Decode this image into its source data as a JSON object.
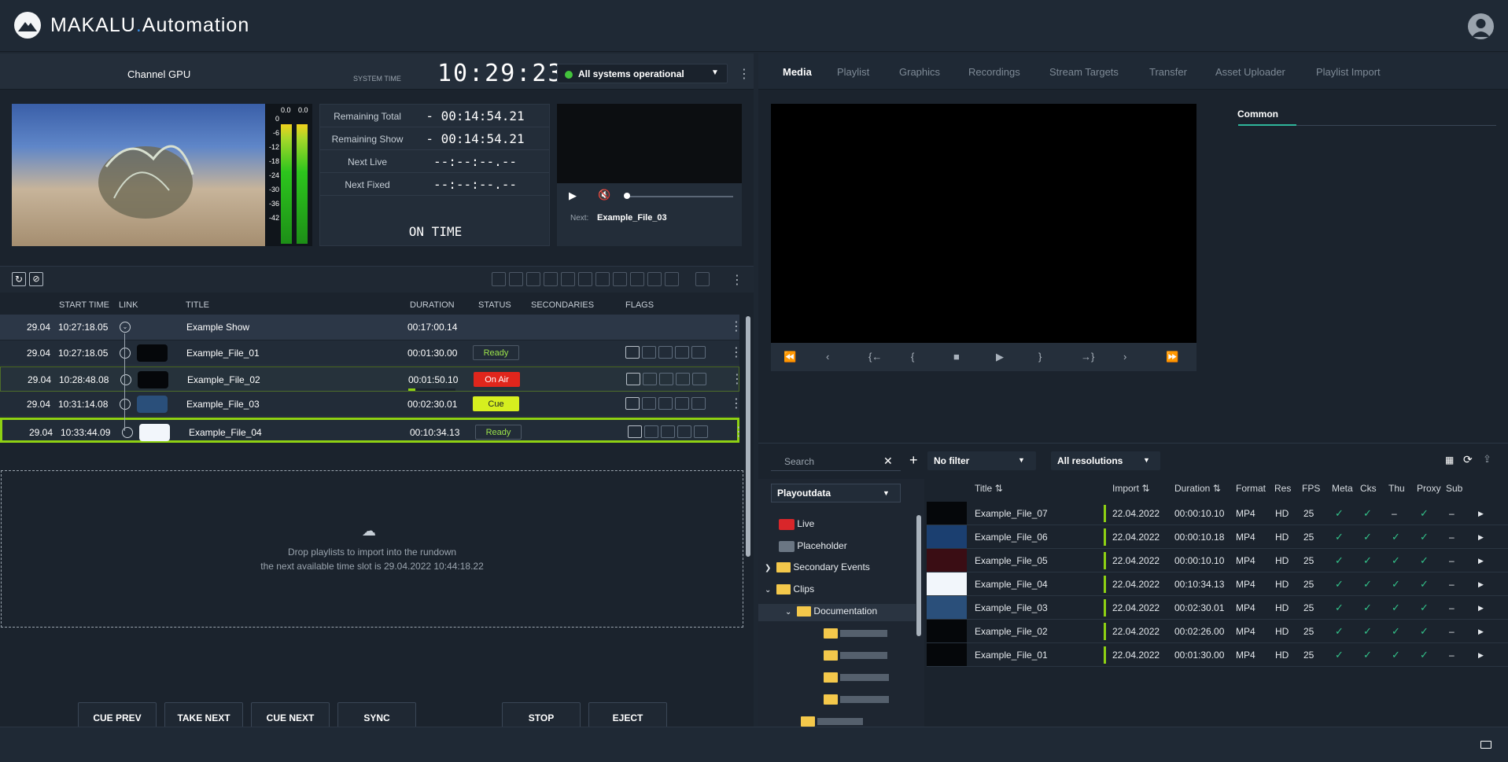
{
  "app": {
    "brand_left": "MAKALU",
    "brand_sep": ".",
    "brand_right": "Automation"
  },
  "channel": {
    "name": "Channel GPU",
    "system_time_label": "SYSTEM TIME",
    "clock": "10:29:23",
    "status": "All systems operational",
    "status_color": "#43c33c"
  },
  "vu": {
    "left_peak": "0.0",
    "right_peak": "0.0",
    "scale": [
      "0",
      "-6",
      "-12",
      "-18",
      "-24",
      "-30",
      "-36",
      "-42"
    ]
  },
  "timers": [
    {
      "label": "Remaining Total",
      "value": "- 00:14:54.21"
    },
    {
      "label": "Remaining Show",
      "value": "- 00:14:54.21"
    },
    {
      "label": "Next Live",
      "value": "--:--:--.--"
    },
    {
      "label": "Next Fixed",
      "value": "--:--:--.--"
    }
  ],
  "on_time": "ON TIME",
  "preview": {
    "next_label": "Next:",
    "next_value": "Example_File_03"
  },
  "rundown": {
    "columns": {
      "start": "START TIME",
      "link": "LINK",
      "title": "TITLE",
      "duration": "DURATION",
      "status": "STATUS",
      "secondaries": "SECONDARIES",
      "flags": "FLAGS"
    },
    "show": {
      "date": "29.04",
      "time": "10:27:18.05",
      "title": "Example Show",
      "duration": "00:17:00.14"
    },
    "items": [
      {
        "date": "29.04",
        "time": "10:27:18.05",
        "title": "Example_File_01",
        "duration": "00:01:30.00",
        "status": "Ready",
        "status_bg": "#222c38",
        "status_fg": "#9be34b",
        "thumb": "#05070a"
      },
      {
        "date": "29.04",
        "time": "10:28:48.08",
        "title": "Example_File_02",
        "duration": "00:01:50.10",
        "status": "On Air",
        "status_bg": "#e0261c",
        "status_fg": "#ffffff",
        "thumb": "#05070a"
      },
      {
        "date": "29.04",
        "time": "10:31:14.08",
        "title": "Example_File_03",
        "duration": "00:02:30.01",
        "status": "Cue",
        "status_bg": "#d6ef1f",
        "status_fg": "#1a1f26",
        "thumb": "#2a4f7a"
      },
      {
        "date": "29.04",
        "time": "10:33:44.09",
        "title": "Example_File_04",
        "duration": "00:10:34.13",
        "status": "Ready",
        "status_bg": "#222c38",
        "status_fg": "#9be34b",
        "thumb": "#f2f6fb"
      }
    ],
    "onair_progress": 0.06,
    "drop_line1": "Drop playlists to import into the rundown",
    "drop_line2": "the next available time slot is 29.04.2022 10:44:18.22"
  },
  "controls": {
    "cue_prev": "CUE PREV",
    "take_next": "TAKE NEXT",
    "cue_next": "CUE NEXT",
    "sync": "SYNC",
    "stop": "STOP",
    "eject": "EJECT"
  },
  "tabs": [
    "Media",
    "Playlist",
    "Graphics",
    "Recordings",
    "Stream Targets",
    "Transfer",
    "Asset Uploader",
    "Playlist Import"
  ],
  "common_tab": "Common",
  "media": {
    "search_placeholder": "Search",
    "filter": "No filter",
    "resolution": "All resolutions",
    "source": "Playoutdata",
    "tree": [
      {
        "label": "Live"
      },
      {
        "label": "Placeholder"
      },
      {
        "label": "Secondary Events"
      },
      {
        "label": "Clips"
      },
      {
        "label": "Documentation"
      }
    ],
    "columns": {
      "title": "Title",
      "import": "Import",
      "duration": "Duration",
      "format": "Format",
      "res": "Res",
      "fps": "FPS",
      "meta": "Meta",
      "cks": "Cks",
      "thu": "Thu",
      "proxy": "Proxy",
      "sub": "Sub"
    },
    "rows": [
      {
        "title": "Example_File_07",
        "import": "22.04.2022",
        "duration": "00:00:10.10",
        "format": "MP4",
        "res": "HD",
        "fps": "25",
        "thu": "–",
        "sub": "–",
        "thumb": "#05070a"
      },
      {
        "title": "Example_File_06",
        "import": "22.04.2022",
        "duration": "00:00:10.18",
        "format": "MP4",
        "res": "HD",
        "fps": "25",
        "thu": "✓",
        "sub": "–",
        "thumb": "#1b3f70"
      },
      {
        "title": "Example_File_05",
        "import": "22.04.2022",
        "duration": "00:00:10.10",
        "format": "MP4",
        "res": "HD",
        "fps": "25",
        "thu": "✓",
        "sub": "–",
        "thumb": "#3a0d14"
      },
      {
        "title": "Example_File_04",
        "import": "22.04.2022",
        "duration": "00:10:34.13",
        "format": "MP4",
        "res": "HD",
        "fps": "25",
        "thu": "✓",
        "sub": "–",
        "thumb": "#f2f6fb"
      },
      {
        "title": "Example_File_03",
        "import": "22.04.2022",
        "duration": "00:02:30.01",
        "format": "MP4",
        "res": "HD",
        "fps": "25",
        "thu": "✓",
        "sub": "–",
        "thumb": "#2a4f7a"
      },
      {
        "title": "Example_File_02",
        "import": "22.04.2022",
        "duration": "00:02:26.00",
        "format": "MP4",
        "res": "HD",
        "fps": "25",
        "thu": "✓",
        "sub": "–",
        "thumb": "#05070a"
      },
      {
        "title": "Example_File_01",
        "import": "22.04.2022",
        "duration": "00:01:30.00",
        "format": "MP4",
        "res": "HD",
        "fps": "25",
        "thu": "✓",
        "sub": "–",
        "thumb": "#05070a"
      }
    ]
  }
}
